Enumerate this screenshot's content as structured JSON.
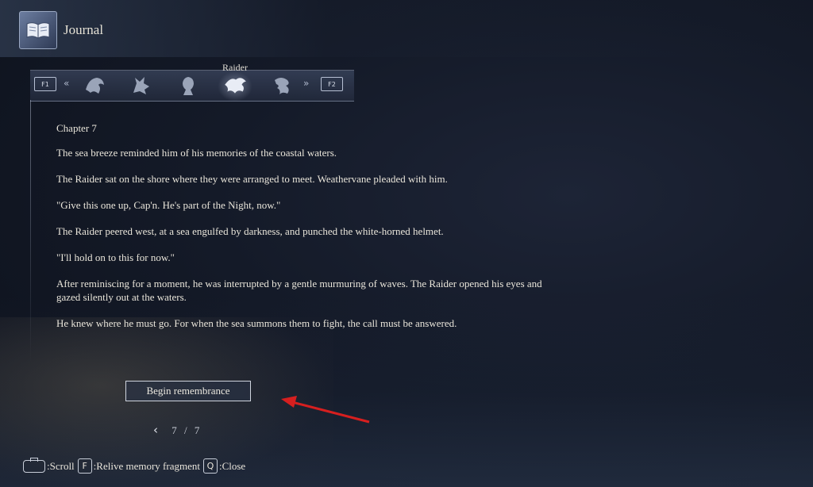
{
  "header": {
    "title": "Journal",
    "icon": "open-book-icon"
  },
  "tabs": {
    "left_key": "F1",
    "right_key": "F2",
    "active_label": "Raider",
    "items": [
      {
        "name": "eagle-crest-icon"
      },
      {
        "name": "beast-crest-icon"
      },
      {
        "name": "hooded-figure-icon"
      },
      {
        "name": "raider-crest-icon",
        "active": true
      },
      {
        "name": "serpent-crest-icon"
      }
    ]
  },
  "content": {
    "chapter": "Chapter 7",
    "paragraphs": [
      "The sea breeze reminded him of his memories of the coastal waters.",
      "The Raider sat on the shore where they were arranged to meet. Weathervane pleaded with him.",
      "\"Give this one up, Cap'n. He's part of the Night, now.\"",
      "The Raider peered west, at a sea engulfed by darkness, and punched the white-horned helmet.",
      "\"I'll hold on to this for now.\"",
      "After reminiscing for a moment, he was interrupted by a gentle murmuring of waves. The Raider opened his eyes and gazed silently out at the waters.",
      "He knew where he must go. For when the sea summons them to fight, the call must be answered."
    ]
  },
  "action": {
    "begin_label": "Begin remembrance"
  },
  "pager": {
    "current": "7",
    "separator": "/",
    "total": "7"
  },
  "footer": {
    "scroll_label": ":Scroll",
    "relive_key": "F",
    "relive_label": ":Relive memory fragment",
    "close_key": "Q",
    "close_label": ":Close"
  },
  "colors": {
    "annotation_arrow": "#d61f1f",
    "text": "#e9e5da",
    "background": "#141a28"
  }
}
